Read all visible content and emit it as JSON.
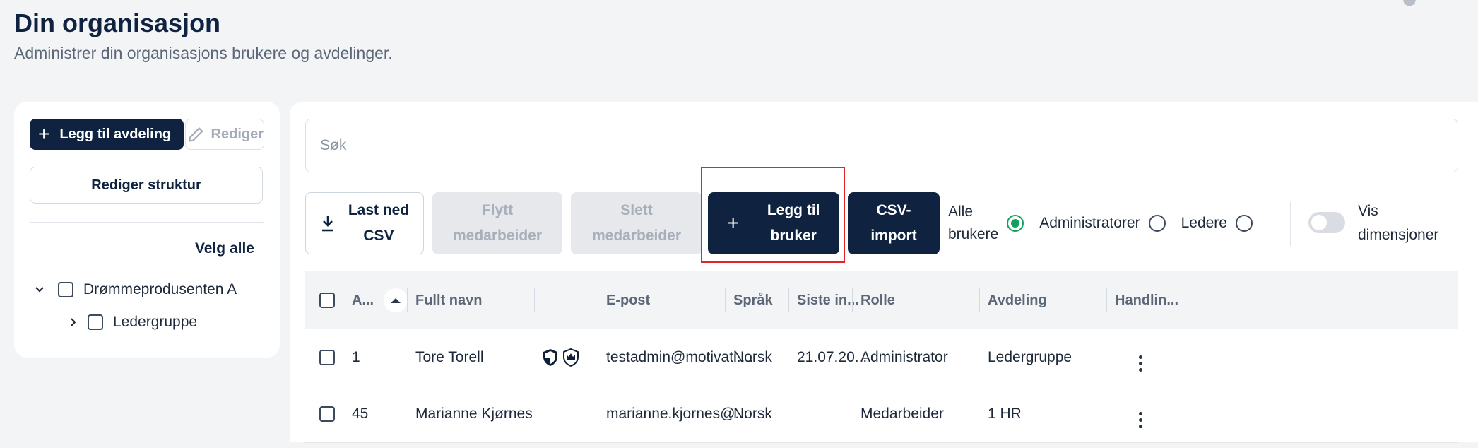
{
  "header": {
    "title": "Din organisasjon",
    "subtitle": "Administrer din organisasjons brukere og avdelinger."
  },
  "left": {
    "add_department": "Legg til avdeling",
    "edit": "Rediger",
    "edit_structure": "Rediger struktur",
    "select_all": "Velg alle",
    "tree": [
      {
        "label": "Drømmeprodusenten A",
        "expanded": true
      },
      {
        "label": "Ledergruppe",
        "expanded": false
      }
    ]
  },
  "toolbar": {
    "search_placeholder": "Søk",
    "download_csv": "Last ned\nCSV",
    "move_employees": "Flytt\nmedarbeider",
    "delete_employees": "Slett\nmedarbeider",
    "add_user": "Legg til\nbruker",
    "csv_import": "CSV-\nimport",
    "filters": [
      {
        "label": "Alle\nbrukere",
        "selected": true
      },
      {
        "label": "Administratorer",
        "selected": false
      },
      {
        "label": "Ledere",
        "selected": false
      }
    ],
    "show_dimensions": "Vis\ndimensjoner",
    "show_dimensions_on": false
  },
  "table": {
    "columns": [
      "A...",
      "Fullt navn",
      "E-post",
      "Språk",
      "Siste in...",
      "Rolle",
      "Avdeling",
      "Handlin..."
    ],
    "rows": [
      {
        "id": "1",
        "name": "Tore Torell",
        "badges": [
          "shield-icon",
          "crown-badge-icon"
        ],
        "email": "testadmin@motivati....",
        "language": "Norsk",
        "last_login": "21.07.20...",
        "role": "Administrator",
        "department": "Ledergruppe"
      },
      {
        "id": "45",
        "name": "Marianne Kjørnes",
        "badges": [],
        "email": "marianne.kjornes@...",
        "language": "Norsk",
        "last_login": "",
        "role": "Medarbeider",
        "department": "1 HR"
      }
    ]
  },
  "colors": {
    "primary": "#0f2340",
    "accent_green": "#12a05c",
    "highlight": "#e0262b"
  }
}
